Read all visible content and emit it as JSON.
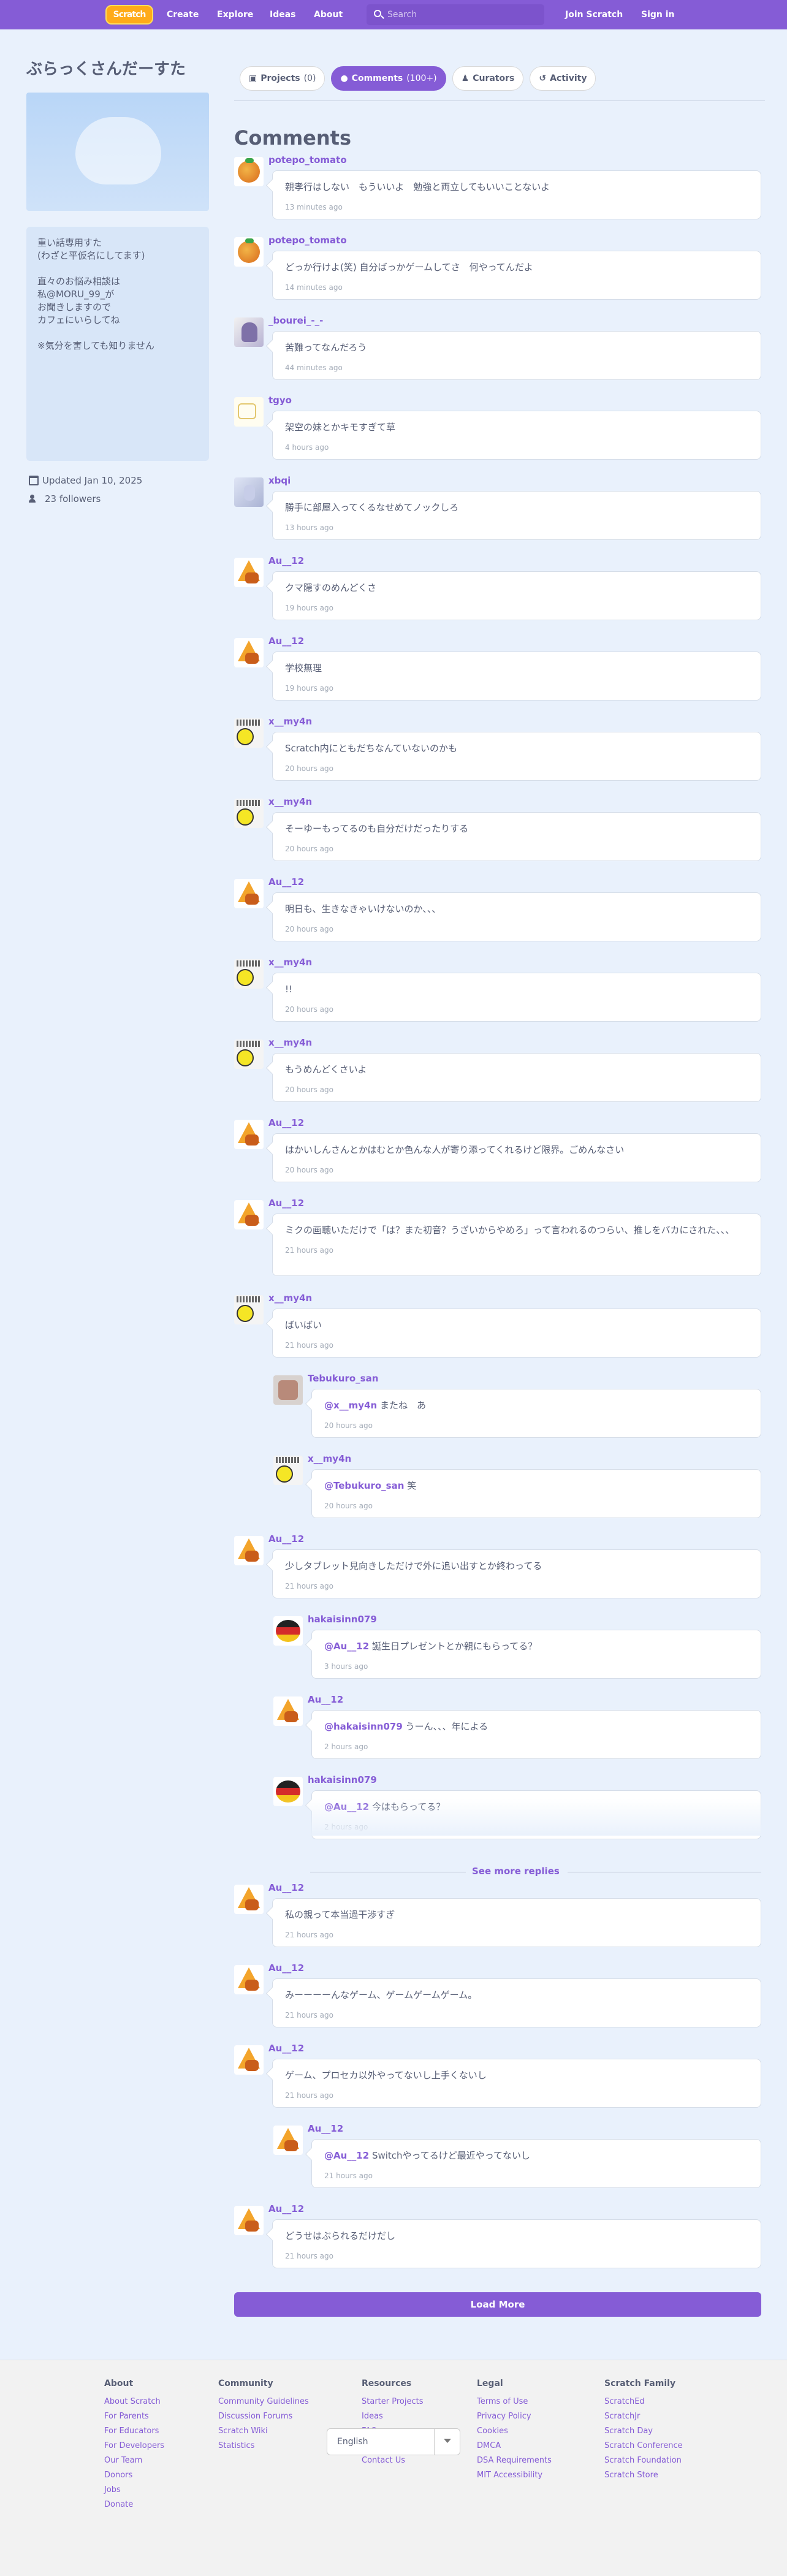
{
  "nav": {
    "logo": "Scratch",
    "create": "Create",
    "explore": "Explore",
    "ideas": "Ideas",
    "about": "About",
    "search_placeholder": "Search",
    "join": "Join Scratch",
    "signin": "Sign in"
  },
  "profile": {
    "username": "ぶらっくさんだーすた",
    "bio_lines": [
      "重い話専用すた",
      "(わざと平仮名にしてます)",
      "",
      "直々のお悩み相談は",
      "私@MORU_99_が",
      "お聞きしますので",
      "カフェにいらしてね",
      "",
      "※気分を害しても知りません"
    ],
    "updated": "Updated Jan 10, 2025",
    "followers": "23 followers"
  },
  "tabs": {
    "projects": "Projects",
    "projects_count": "(0)",
    "comments": "Comments",
    "comments_count": "(100+)",
    "curators": "Curators",
    "activity": "Activity"
  },
  "heading": "Comments",
  "comments": [
    {
      "user": "potepo_tomato",
      "text": "親孝行はしない　もういいよ　勉強と両立してもいいことないよ",
      "time": "13 minutes ago"
    },
    {
      "user": "potepo_tomato",
      "text": "どっか行けよ(笑) 自分ばっかゲームしてさ　何やってんだよ",
      "time": "14 minutes ago"
    },
    {
      "user": "_bourei_-_-",
      "text": "苦難ってなんだろう",
      "time": "44 minutes ago"
    },
    {
      "user": "tgyo",
      "text": "架空の妹とかキモすぎて草",
      "time": "4 hours ago"
    },
    {
      "user": "xbqi",
      "text": "勝手に部屋入ってくるなせめてノックしろ",
      "time": "13 hours ago"
    },
    {
      "user": "Au__12",
      "text": "クマ隠すのめんどくさ",
      "time": "19 hours ago"
    },
    {
      "user": "Au__12",
      "text": "学校無理",
      "time": "19 hours ago"
    },
    {
      "user": "x__my4n",
      "text": "Scratch内にともだちなんていないのかも",
      "time": "20 hours ago"
    },
    {
      "user": "x__my4n",
      "text": "そーゆーもってるのも自分だけだったりする",
      "time": "20 hours ago"
    },
    {
      "user": "Au__12",
      "text": "明日も、生きなきゃいけないのか、、、",
      "time": "20 hours ago"
    },
    {
      "user": "x__my4n",
      "text": "!!",
      "time": "20 hours ago"
    },
    {
      "user": "x__my4n",
      "text": "もうめんどくさいよ",
      "time": "20 hours ago"
    },
    {
      "user": "Au__12",
      "text": "はかいしんさんとかはむとか色んな人が寄り添ってくれるけど限界。ごめんなさい",
      "time": "20 hours ago"
    },
    {
      "user": "Au__12",
      "text": "ミクの画聴いただけで「は？また初音？うざいからやめろ」って言われるのつらい、推しをバカにされた、、、",
      "time": "21 hours ago"
    },
    {
      "user": "x__my4n",
      "text": "ばいばい",
      "time": "21 hours ago"
    },
    {
      "user": "Tebukuro_san",
      "mention": "@x__my4n",
      "text": " またね　あ",
      "time": "20 hours ago"
    },
    {
      "user": "x__my4n",
      "mention": "@Tebukuro_san",
      "text": " 笑",
      "time": "20 hours ago"
    },
    {
      "user": "Au__12",
      "text": "少しタブレット見向きしただけで外に追い出すとか終わってる",
      "time": "21 hours ago"
    },
    {
      "user": "hakaisinn079",
      "mention": "@Au__12",
      "text": " 誕生日プレゼントとか親にもらってる？",
      "time": "3 hours ago"
    },
    {
      "user": "Au__12",
      "mention": "@hakaisinn079",
      "text": " うーん、、、年による",
      "time": "2 hours ago"
    },
    {
      "user": "hakaisinn079",
      "mention": "@Au__12",
      "text": " 今はもらってる？",
      "time": "2 hours ago"
    },
    {
      "user": "Au__12",
      "text": "私の親って本当過干渉すぎ",
      "time": "21 hours ago"
    },
    {
      "user": "Au__12",
      "text": "みーーーーんなゲーム、ゲームゲームゲーム。",
      "time": "21 hours ago"
    },
    {
      "user": "Au__12",
      "text": "ゲーム、プロセカ以外やってないし上手くないし",
      "time": "21 hours ago"
    },
    {
      "user": "Au__12",
      "mention": "@Au__12",
      "text": " Switchやってるけど最近やってないし",
      "time": "21 hours ago"
    },
    {
      "user": "Au__12",
      "text": "どうせはぶられるだけだし",
      "time": "21 hours ago"
    }
  ],
  "see_more_replies": "See more replies",
  "load_more": "Load More",
  "footer": {
    "about": {
      "title": "About",
      "links": [
        "About Scratch",
        "For Parents",
        "For Educators",
        "For Developers",
        "Our Team",
        "Donors",
        "Jobs",
        "Donate"
      ]
    },
    "community": {
      "title": "Community",
      "links": [
        "Community Guidelines",
        "Discussion Forums",
        "Scratch Wiki",
        "Statistics"
      ]
    },
    "resources": {
      "title": "Resources",
      "links": [
        "Starter Projects",
        "Ideas",
        "FAQ",
        "Download",
        "Contact Us"
      ]
    },
    "legal": {
      "title": "Legal",
      "links": [
        "Terms of Use",
        "Privacy Policy",
        "Cookies",
        "DMCA",
        "DSA Requirements",
        "MIT Accessibility"
      ]
    },
    "family": {
      "title": "Scratch Family",
      "links": [
        "ScratchEd",
        "ScratchJr",
        "Scratch Day",
        "Scratch Conference",
        "Scratch Foundation",
        "Scratch Store"
      ]
    },
    "language": "English"
  }
}
